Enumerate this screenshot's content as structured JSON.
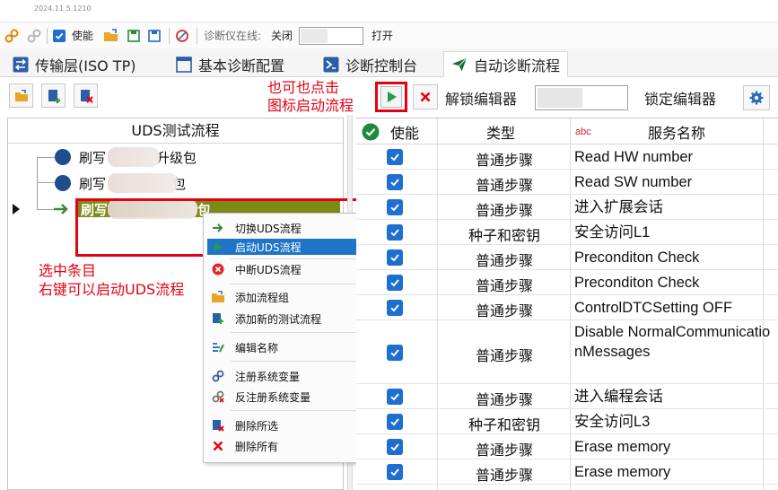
{
  "app": {
    "version": "2024.11.5.1210"
  },
  "topbar": {
    "enable_label": "使能",
    "online_label": "诊断仪在线:",
    "online_value": "关闭",
    "open_label": "打开"
  },
  "tabs": [
    {
      "label": "传输层(ISO TP)",
      "icon": "swap-icon"
    },
    {
      "label": "基本诊断配置",
      "icon": "window-icon"
    },
    {
      "label": "诊断控制台",
      "icon": "console-icon"
    },
    {
      "label": "自动诊断流程",
      "icon": "send-icon",
      "active": true
    }
  ],
  "toolbar": {
    "unlock_label": "解锁编辑器",
    "lock_label": "锁定编辑器"
  },
  "annotations": {
    "top_line1": "也可也点击",
    "top_line2": "图标启动流程",
    "left_line1": "选中条目",
    "left_line2": "右键可以启动UDS流程"
  },
  "tree": {
    "header": "UDS测试流程",
    "items": [
      {
        "prefix": "刷写",
        "suffix": "升级包"
      },
      {
        "prefix": "刷写",
        "suffix": "包"
      },
      {
        "prefix": "刷写",
        "suffix": "包",
        "selected": true
      }
    ]
  },
  "context_menu": {
    "items": [
      {
        "label": "切换UDS流程",
        "icon": "arrow-right-icon"
      },
      {
        "label": "启动UDS流程",
        "icon": "play-icon",
        "highlighted": true
      },
      {
        "label": "中断UDS流程",
        "icon": "stop-icon"
      },
      {
        "label": "添加流程组",
        "icon": "folder-add-icon"
      },
      {
        "label": "添加新的测试流程",
        "icon": "file-add-icon"
      },
      {
        "label": "编辑名称",
        "icon": "rename-icon"
      },
      {
        "label": "注册系统变量",
        "icon": "link-icon"
      },
      {
        "label": "反注册系统变量",
        "icon": "unlink-icon"
      },
      {
        "label": "删除所选",
        "icon": "delete-selected-icon"
      },
      {
        "label": "删除所有",
        "icon": "delete-all-icon"
      }
    ]
  },
  "grid": {
    "columns": {
      "enable": "使能",
      "type": "类型",
      "abc": "abc",
      "name": "服务名称"
    },
    "rows": [
      {
        "enabled": true,
        "type": "普通步骤",
        "name": "Read HW number"
      },
      {
        "enabled": true,
        "type": "普通步骤",
        "name": "Read SW number"
      },
      {
        "enabled": true,
        "type": "普通步骤",
        "name": "进入扩展会话"
      },
      {
        "enabled": true,
        "type": "种子和密钥",
        "name": "安全访问L1"
      },
      {
        "enabled": true,
        "type": "普通步骤",
        "name": "Preconditon Check"
      },
      {
        "enabled": true,
        "type": "普通步骤",
        "name": "Preconditon Check"
      },
      {
        "enabled": true,
        "type": "普通步骤",
        "name": "ControlDTCSetting OFF"
      },
      {
        "enabled": true,
        "type": "普通步骤",
        "name": "Disable NormalCommunicationMessages"
      },
      {
        "enabled": true,
        "type": "普通步骤",
        "name": "进入编程会话"
      },
      {
        "enabled": true,
        "type": "种子和密钥",
        "name": "安全访问L3"
      },
      {
        "enabled": true,
        "type": "普通步骤",
        "name": "Erase memory"
      },
      {
        "enabled": true,
        "type": "普通步骤",
        "name": "Erase memory"
      }
    ]
  },
  "colors": {
    "accent": "#1e6fd0",
    "annotation": "#e60012",
    "selected_row": "#7c8a18",
    "play": "#1e9e48"
  }
}
